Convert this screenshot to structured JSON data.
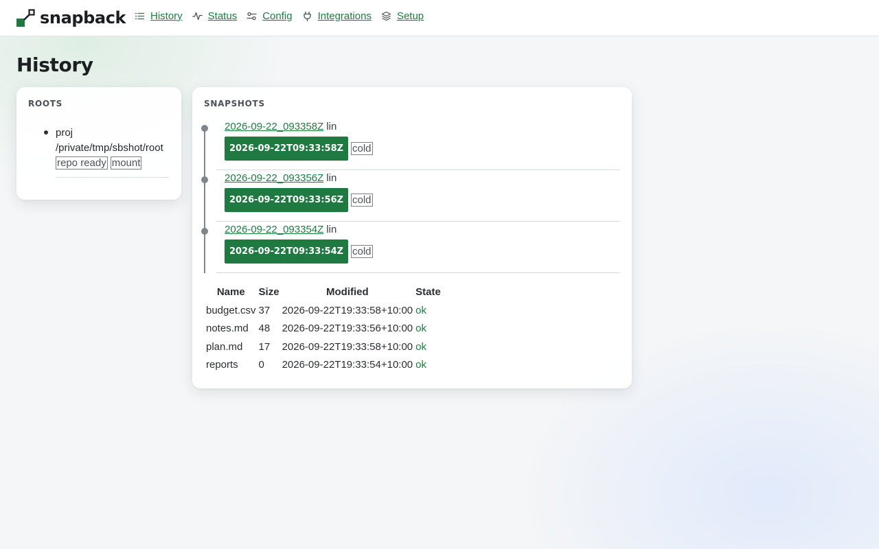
{
  "brand": {
    "name": "snapback"
  },
  "nav": {
    "items": [
      {
        "label": "History",
        "icon": "list-icon"
      },
      {
        "label": "Status",
        "icon": "pulse-icon"
      },
      {
        "label": "Config",
        "icon": "sliders-icon"
      },
      {
        "label": "Integrations",
        "icon": "plug-icon"
      },
      {
        "label": "Setup",
        "icon": "layers-icon"
      }
    ]
  },
  "page": {
    "title": "History"
  },
  "roots": {
    "heading": "ROOTS",
    "items": [
      {
        "name": "proj",
        "path": "/private/tmp/sbshot/root",
        "tags": [
          "repo ready",
          "mount"
        ]
      }
    ]
  },
  "snapshots": {
    "heading": "SNAPSHOTS",
    "items": [
      {
        "id": "2026-09-22_093358Z",
        "host": "lin",
        "timestamp": "2026-09-22T09:33:58Z",
        "tier": "cold"
      },
      {
        "id": "2026-09-22_093356Z",
        "host": "lin",
        "timestamp": "2026-09-22T09:33:56Z",
        "tier": "cold"
      },
      {
        "id": "2026-09-22_093354Z",
        "host": "lin",
        "timestamp": "2026-09-22T09:33:54Z",
        "tier": "cold"
      }
    ]
  },
  "files": {
    "columns": [
      "Name",
      "Size",
      "Modified",
      "State"
    ],
    "rows": [
      {
        "name": "budget.csv",
        "size": "37",
        "modified": "2026-09-22T19:33:58+10:00",
        "state": "ok"
      },
      {
        "name": "notes.md",
        "size": "48",
        "modified": "2026-09-22T19:33:56+10:00",
        "state": "ok"
      },
      {
        "name": "plan.md",
        "size": "17",
        "modified": "2026-09-22T19:33:58+10:00",
        "state": "ok"
      },
      {
        "name": "reports",
        "size": "0",
        "modified": "2026-09-22T19:33:54+10:00",
        "state": "ok"
      }
    ]
  },
  "colors": {
    "accent": "#1f7a41",
    "timeline": "#7e858b"
  }
}
